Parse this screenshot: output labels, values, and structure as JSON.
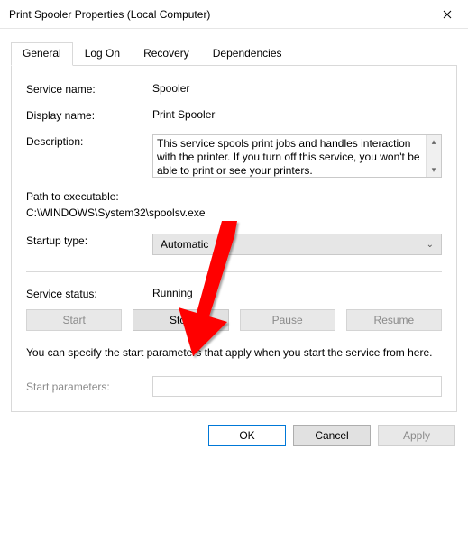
{
  "window": {
    "title": "Print Spooler Properties (Local Computer)"
  },
  "tabs": {
    "general": "General",
    "logon": "Log On",
    "recovery": "Recovery",
    "dependencies": "Dependencies"
  },
  "labels": {
    "service_name": "Service name:",
    "display_name": "Display name:",
    "description": "Description:",
    "path": "Path to executable:",
    "startup_type": "Startup type:",
    "service_status": "Service status:",
    "start_parameters": "Start parameters:"
  },
  "values": {
    "service_name": "Spooler",
    "display_name": "Print Spooler",
    "description": "This service spools print jobs and handles interaction with the printer.  If you turn off this service, you won't be able to print or see your printers.",
    "path": "C:\\WINDOWS\\System32\\spoolsv.exe",
    "startup_type": "Automatic",
    "service_status": "Running"
  },
  "buttons": {
    "start": "Start",
    "stop": "Stop",
    "pause": "Pause",
    "resume": "Resume",
    "ok": "OK",
    "cancel": "Cancel",
    "apply": "Apply"
  },
  "hint": "You can specify the start parameters that apply when you start the service from here."
}
